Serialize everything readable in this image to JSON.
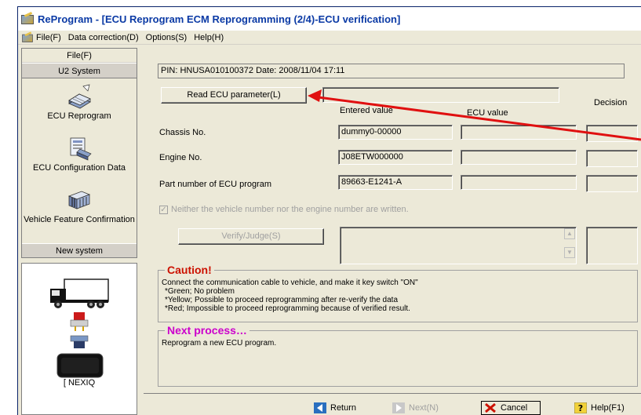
{
  "window": {
    "title": "ReProgram - [ECU Reprogram ECM Reprogramming (2/4)-ECU verification]"
  },
  "menu": [
    "File(F)",
    "Data correction(D)",
    "Options(S)",
    "Help(H)"
  ],
  "sidebar": {
    "header": "File(F)",
    "group": "U2 System",
    "items": [
      {
        "label": "ECU Reprogram",
        "icon": "ecu-reprogram-icon"
      },
      {
        "label": "ECU Configuration Data",
        "icon": "ecu-configuration-icon"
      },
      {
        "label": "Vehicle Feature Confirmation",
        "icon": "vehicle-feature-icon"
      }
    ],
    "new_system": "New system",
    "device_label": "[ NEXIQ"
  },
  "main": {
    "pin_info": "PIN: HNUSA010100372 Date: 2008/11/04 17:11",
    "read_button": "Read ECU parameter(L)",
    "headers": {
      "entered": "Entered value",
      "ecu": "ECU value",
      "decision": "Decision"
    },
    "rows": [
      {
        "label": "Chassis No.",
        "entered": "dummy0-00000",
        "ecu": "",
        "decision": ""
      },
      {
        "label": "Engine No.",
        "entered": "J08ETW000000",
        "ecu": "",
        "decision": ""
      },
      {
        "label": "Part number of ECU program",
        "entered": "89663-E1241-A",
        "ecu": "",
        "decision": ""
      }
    ],
    "checkbox_label": "Neither the vehicle number nor the engine number are written.",
    "verify_button": "Verify/Judge(S)",
    "caution": {
      "title": "Caution!",
      "lines": [
        "Connect the communication cable to vehicle, and make it key switch \"ON\"",
        "*Green; No problem",
        "*Yellow; Possible to proceed reprogramming after re-verify the data",
        "*Red; Impossible to proceed reprogramming because of verified result."
      ],
      "color": "#cc1100"
    },
    "next": {
      "title": "Next process…",
      "text": "Reprogram a new ECU program.",
      "color": "#cc00cc"
    }
  },
  "bottom": {
    "return": "Return",
    "next": "Next(N)",
    "cancel": "Cancel",
    "help": "Help(F1)"
  },
  "colors": {
    "title_text": "#0b3aa5",
    "annotation_arrow": "#e01010"
  }
}
